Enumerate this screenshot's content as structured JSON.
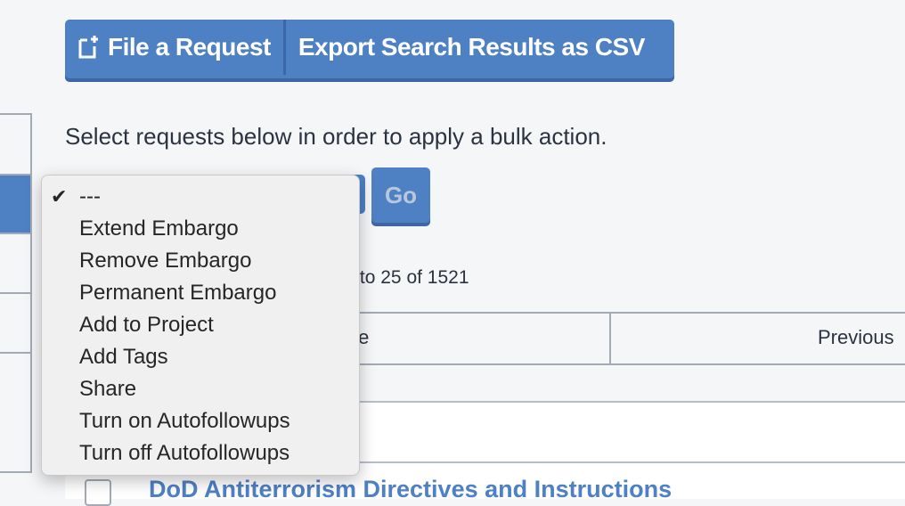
{
  "toolbar": {
    "file_request_label": "File a Request",
    "file_request_icon": "new-document-plus-icon",
    "export_label": "Export Search Results as CSV"
  },
  "bulk": {
    "hint": "Select requests below in order to apply a bulk action.",
    "go_label": "Go",
    "selected": "---",
    "options": [
      "---",
      "Extend Embargo",
      "Remove Embargo",
      "Permanent Embargo",
      "Add to Project",
      "Add Tags",
      "Share",
      "Turn on Autofollowups",
      "Turn off Autofollowups"
    ]
  },
  "results": {
    "showing": "Showing 1 to 25 of 1521",
    "pager_left": "Page",
    "pager_previous": "Previous",
    "first_title": "DoD Antiterrorism Directives and Instructions"
  },
  "colors": {
    "accent": "#4e80c4",
    "accent_dark": "#3c66a6",
    "background": "#f5f6f8"
  }
}
